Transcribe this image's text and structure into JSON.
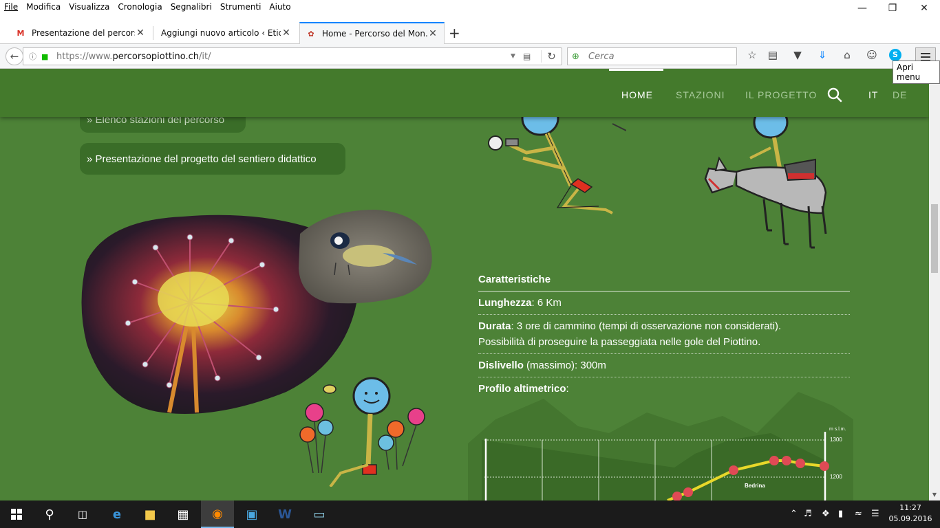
{
  "menubar": {
    "items": [
      "File",
      "Modifica",
      "Visualizza",
      "Cronologia",
      "Segnalibri",
      "Strumenti",
      "Aiuto"
    ]
  },
  "tabs": [
    {
      "label": "Presentazione del percors...",
      "icon": "gmail-icon",
      "active": false
    },
    {
      "label": "Aggiungi nuovo articolo ‹ Etici...",
      "icon": "wordpress-icon",
      "active": false
    },
    {
      "label": "Home - Percorso del Mon...",
      "icon": "site-favicon-icon",
      "active": true
    }
  ],
  "navbar": {
    "url_prefix": "https://www.",
    "url_domain": "percorsopiottino.ch",
    "url_path": "/it/",
    "search_placeholder": "Cerca",
    "menu_tooltip": "Apri menu"
  },
  "site": {
    "nav": [
      {
        "label": "HOME",
        "active": true
      },
      {
        "label": "STAZIONI",
        "active": false
      },
      {
        "label": "IL PROGETTO",
        "active": false
      }
    ],
    "languages": [
      "IT",
      "DE"
    ],
    "links": [
      "» Elenco stazioni del percorso",
      "» Presentazione del progetto del sentiero didattico"
    ],
    "characteristics": {
      "heading": "Caratteristiche",
      "length_label": "Lunghezza",
      "length_value": ": 6 Km",
      "duration_label": "Durata",
      "duration_value": ": 3 ore di cammino (tempi di osservazione non considerati).",
      "duration_extra": "Possibilità di proseguire la passeggiata nelle gole del Piottino.",
      "elevation_label": "Dislivello",
      "elevation_value": " (massimo): 300m",
      "profile_label": "Profilo altimetrico",
      "profile_suffix": ":"
    },
    "profile_chart": {
      "unit_label": "m s.l.m.",
      "ticks": [
        "1300",
        "1200"
      ],
      "place_label": "Bedrina"
    }
  },
  "taskbar": {
    "time": "11:27",
    "date": "05.09.2016"
  }
}
